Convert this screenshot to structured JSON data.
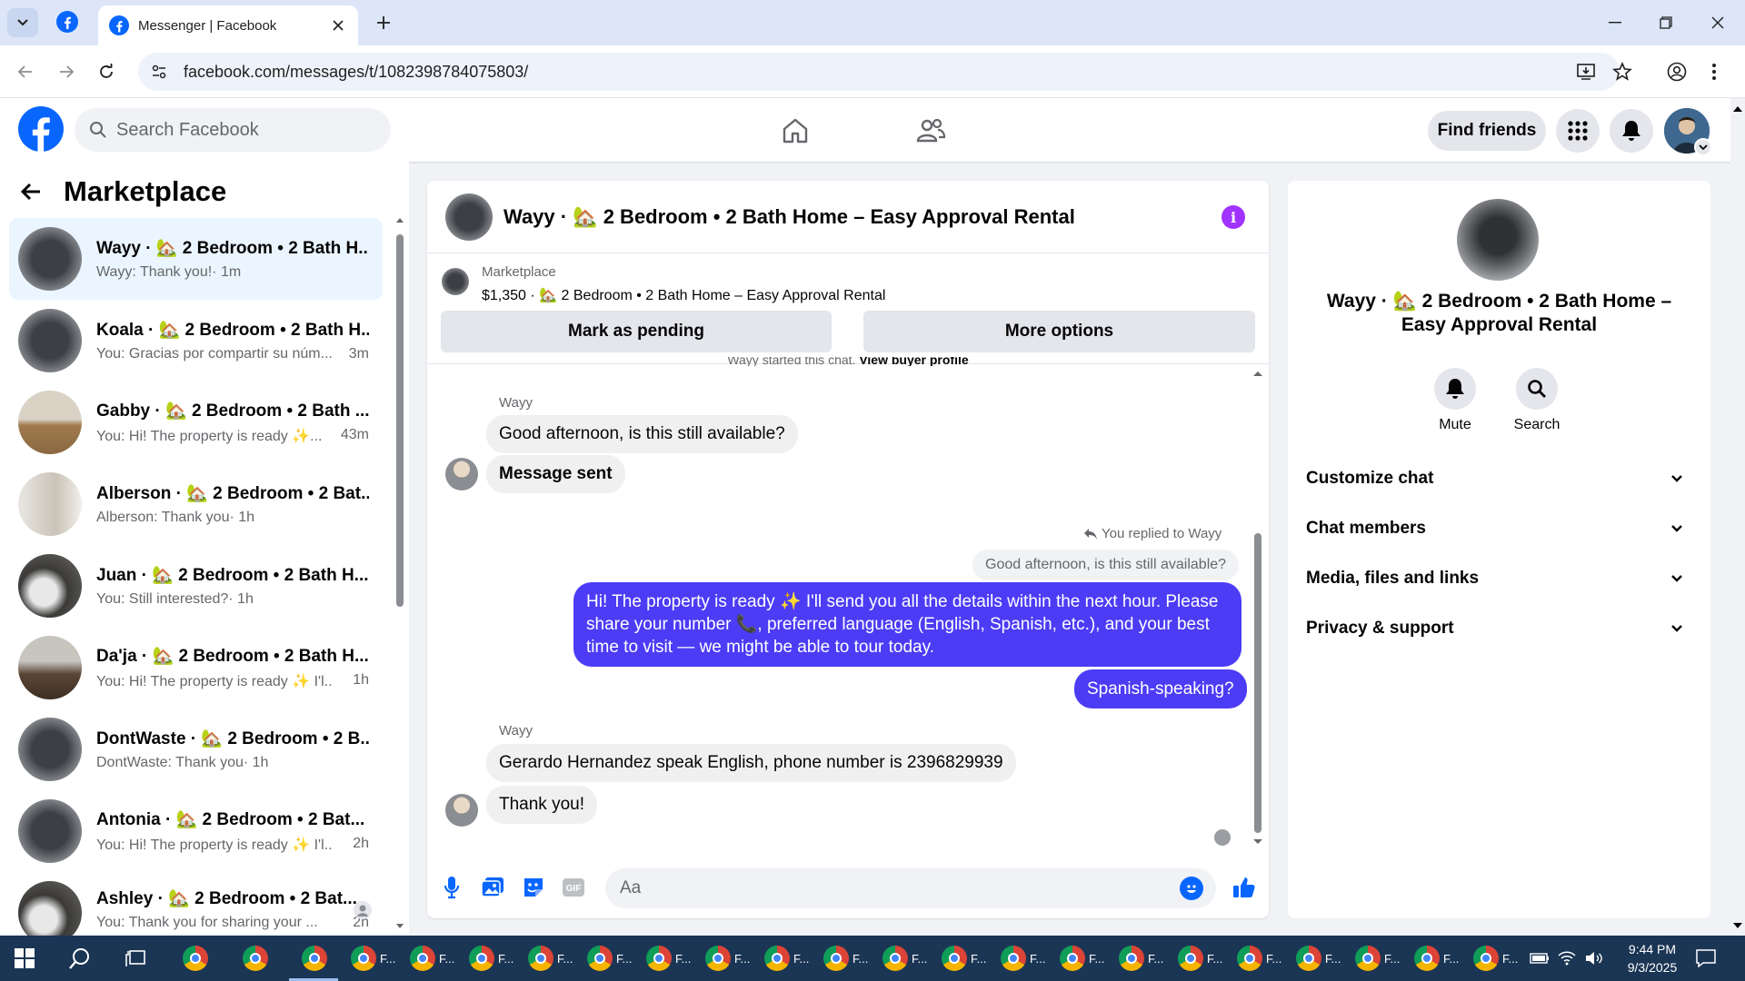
{
  "browser": {
    "tab_title": "Messenger | Facebook",
    "url": "facebook.com/messages/t/1082398784075803/"
  },
  "fb_header": {
    "search_placeholder": "Search Facebook",
    "find_friends": "Find friends"
  },
  "sidebar": {
    "title": "Marketplace",
    "conversations": [
      {
        "name": "Wayy · 🏡 2 Bedroom • 2 Bath H...",
        "preview": "Wayy: Thank you!",
        "time": " · 1m",
        "active": true
      },
      {
        "name": "Koala · 🏡 2 Bedroom • 2 Bath H...",
        "preview": "You: Gracias por compartir su núm...",
        "time": "3m"
      },
      {
        "name": "Gabby · 🏡 2 Bedroom • 2 Bath ...",
        "preview": "You: Hi! The property is ready ✨...",
        "time": "43m"
      },
      {
        "name": "Alberson · 🏡 2 Bedroom • 2 Bat...",
        "preview": "Alberson: Thank you",
        "time": " · 1h"
      },
      {
        "name": "Juan · 🏡 2 Bedroom • 2 Bath H...",
        "preview": "You: Still interested?",
        "time": " · 1h"
      },
      {
        "name": "Da'ja · 🏡 2 Bedroom • 2 Bath H...",
        "preview": "You: Hi! The property is ready ✨ I'l...",
        "time": "1h"
      },
      {
        "name": "DontWaste · 🏡 2 Bedroom • 2 B...",
        "preview": "DontWaste: Thank you",
        "time": " · 1h"
      },
      {
        "name": "Antonia · 🏡 2 Bedroom • 2 Bat...",
        "preview": "You: Hi! The property is ready ✨ I'l...",
        "time": "2h"
      },
      {
        "name": "Ashley · 🏡 2 Bedroom • 2 Bat...",
        "preview": "You: Thank you for sharing your ...",
        "time": "2h"
      }
    ]
  },
  "chat": {
    "title": "Wayy · 🏡 2 Bedroom • 2 Bath Home – Easy Approval Rental",
    "marketplace_label": "Marketplace",
    "listing": "$1,350 · 🏡 2 Bedroom • 2 Bath Home – Easy Approval Rental",
    "mark_pending": "Mark as pending",
    "more_options": "More options",
    "started_text": "Wayy started this chat.",
    "view_buyer_profile": "View buyer profile",
    "sender_name": "Wayy",
    "messages": {
      "m1": "Good afternoon, is this still available?",
      "m2": "Message sent",
      "replied_label": "You replied to Wayy",
      "quoted": "Good afternoon, is this still available?",
      "m3": "Hi! The property is ready ✨ I'll send you all the details within the next hour. Please share your number 📞, preferred language (English, Spanish, etc.), and your best time to visit — we might be able to tour today.",
      "m4": "Spanish-speaking?",
      "m5": "Gerardo Hernandez speak English, phone number is 2396829939",
      "m6": "Thank you!"
    },
    "composer_placeholder": "Aa"
  },
  "info_panel": {
    "title": "Wayy · 🏡 2 Bedroom • 2 Bath Home – Easy Approval Rental",
    "mute": "Mute",
    "search": "Search",
    "sections": [
      "Customize chat",
      "Chat members",
      "Media, files and links",
      "Privacy & support"
    ]
  },
  "taskbar": {
    "window_label": "F...",
    "time": "9:44 PM",
    "date": "9/3/2025"
  },
  "colors": {
    "fb_blue": "#0866ff",
    "outgoing_bubble": "#4c3cf5",
    "info_purple": "#a033ff"
  }
}
